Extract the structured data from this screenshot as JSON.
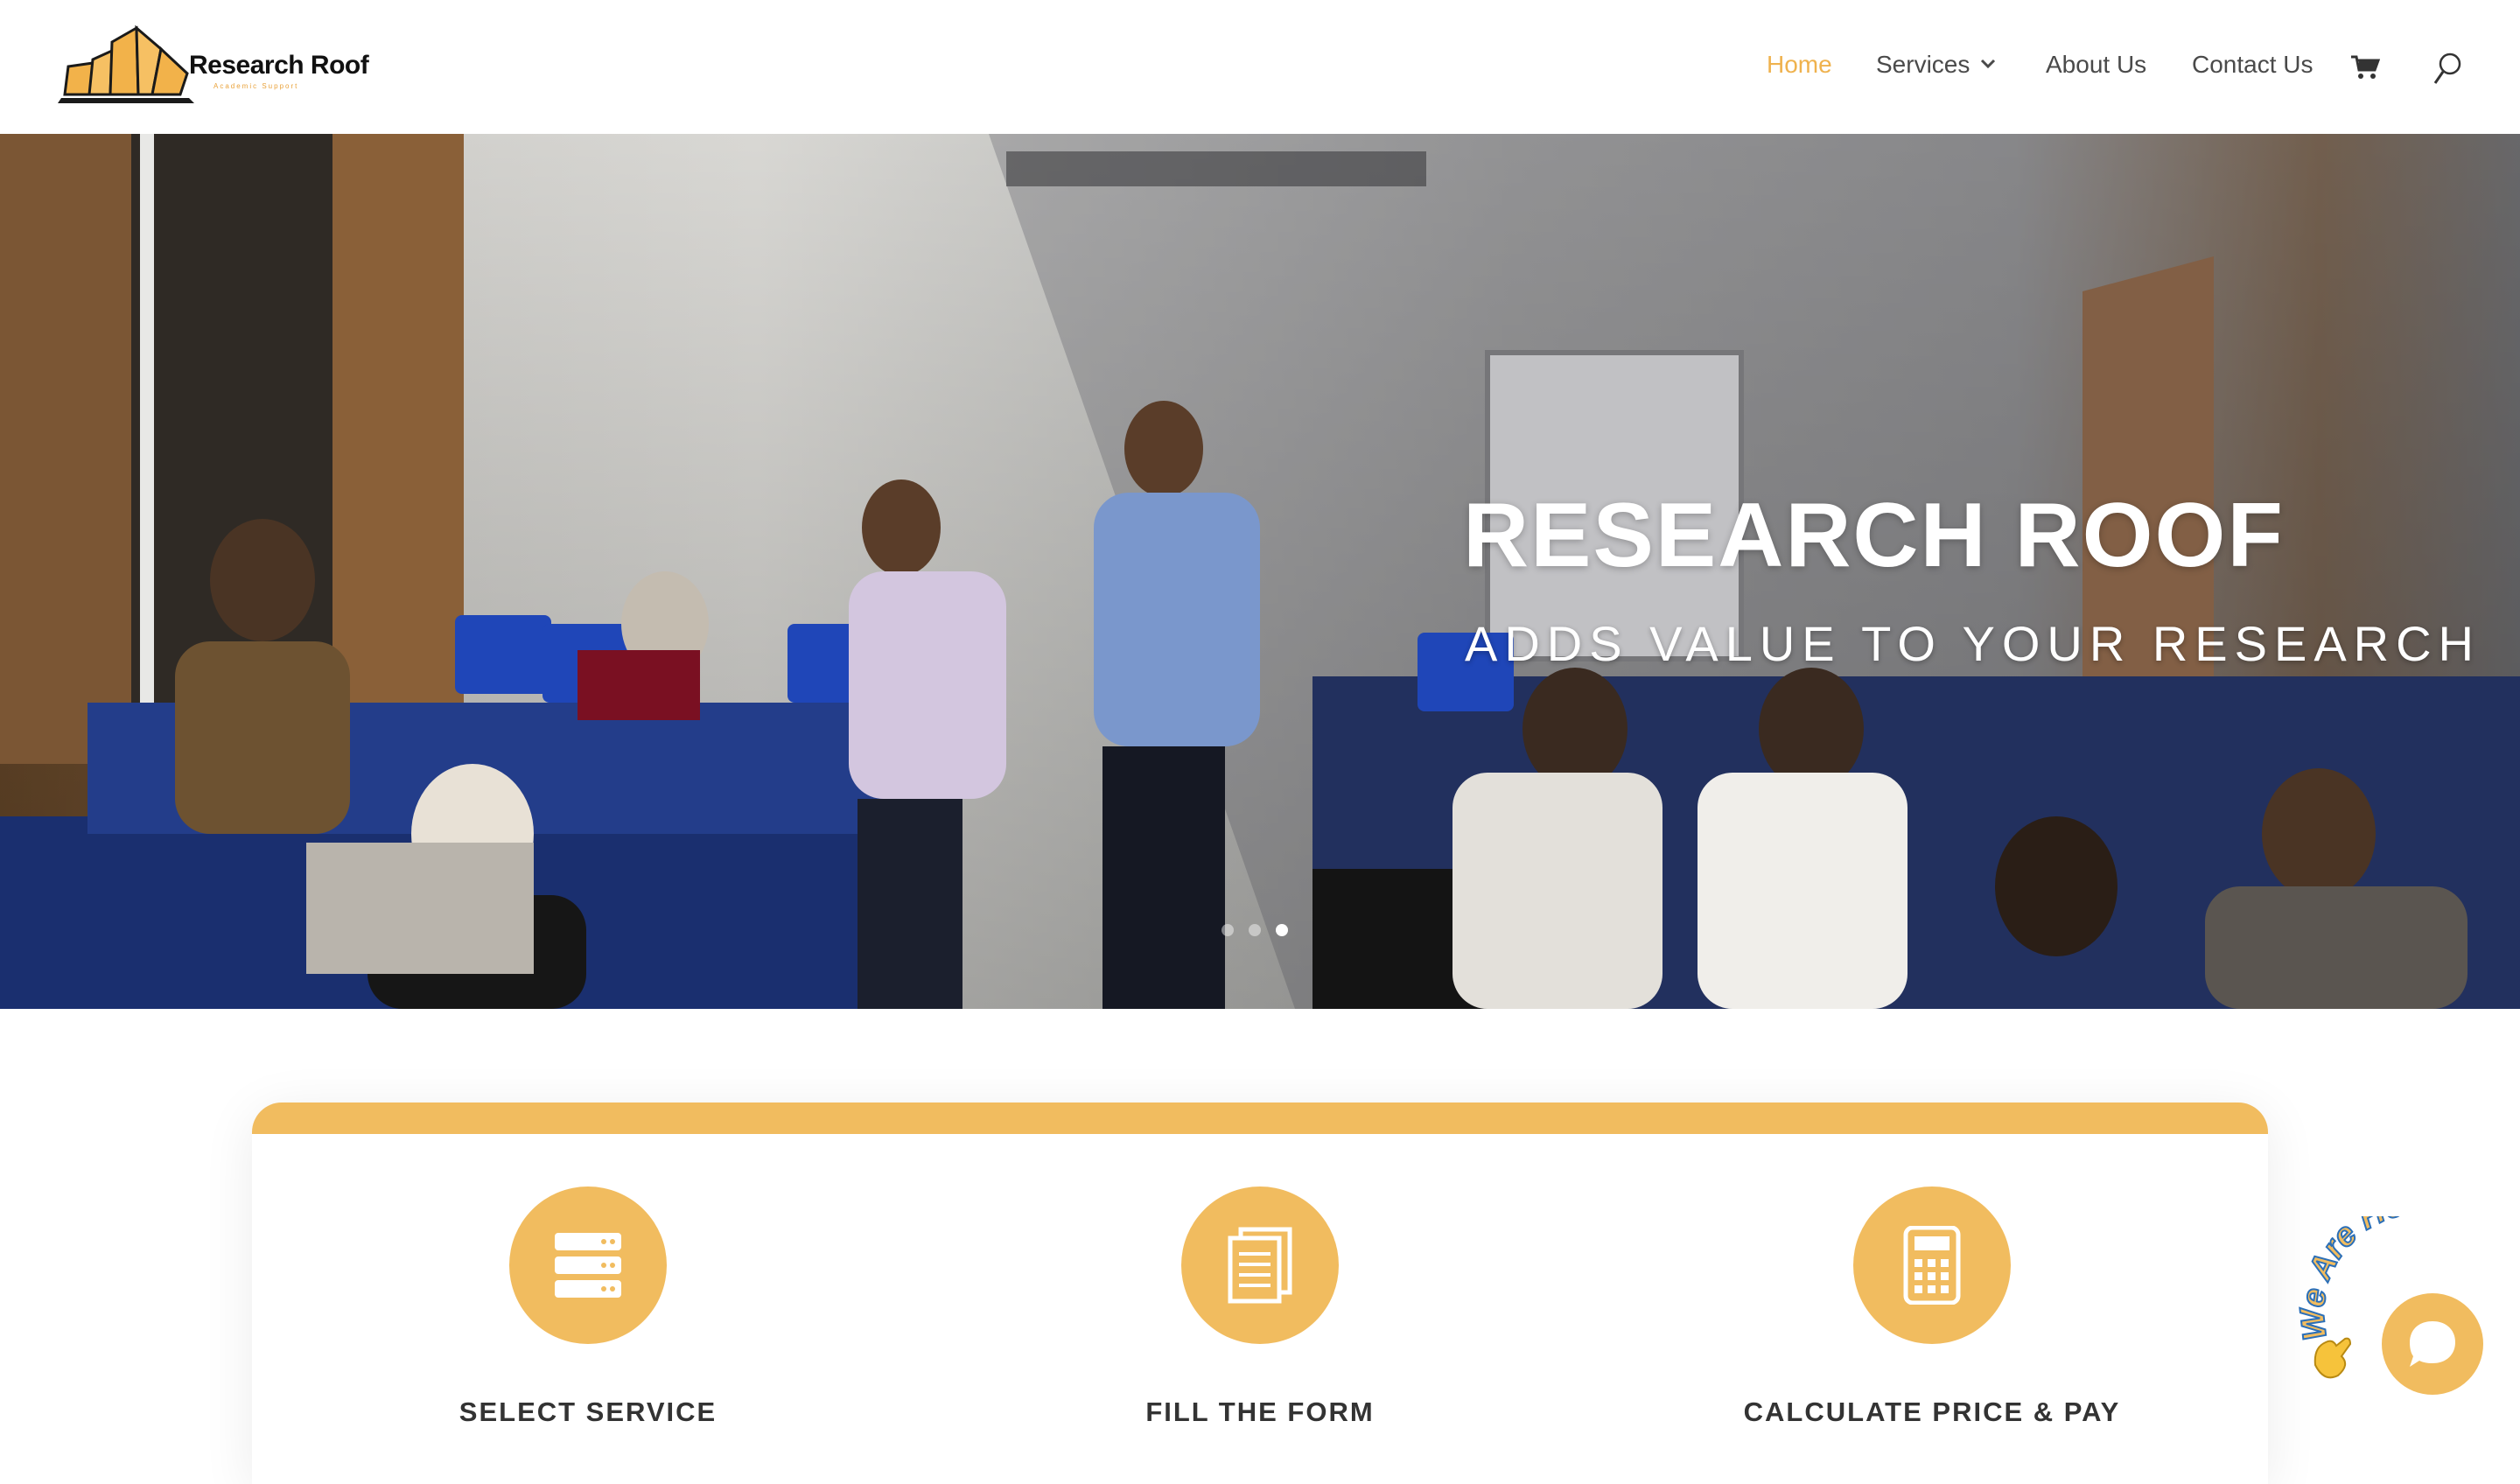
{
  "header": {
    "logo_title": "Research Roof",
    "logo_subtitle": "Academic Support",
    "nav": [
      {
        "label": "Home",
        "active": true
      },
      {
        "label": "Services",
        "active": false
      },
      {
        "label": "About Us",
        "active": false
      },
      {
        "label": "Contact Us",
        "active": false
      }
    ],
    "icons": [
      "chevron-down-icon",
      "cart-icon",
      "search-icon"
    ]
  },
  "hero": {
    "title": "RESEARCH ROOF",
    "subtitle": "ADDS VALUE TO YOUR RESEARCH",
    "slides": 3,
    "active_slide": 3
  },
  "steps": [
    {
      "label": "SELECT SERVICE",
      "icon": "server-list-icon"
    },
    {
      "label": "FILL THE FORM",
      "icon": "document-icon"
    },
    {
      "label": "CALCULATE PRICE & PAY",
      "icon": "calculator-icon"
    }
  ],
  "chat_widget": {
    "label": "We Are Here!",
    "icon": "chat-bubble-icon"
  },
  "colors": {
    "accent": "#f1bc5f",
    "nav_active": "#efb24e",
    "text": "#4a4a4a"
  }
}
